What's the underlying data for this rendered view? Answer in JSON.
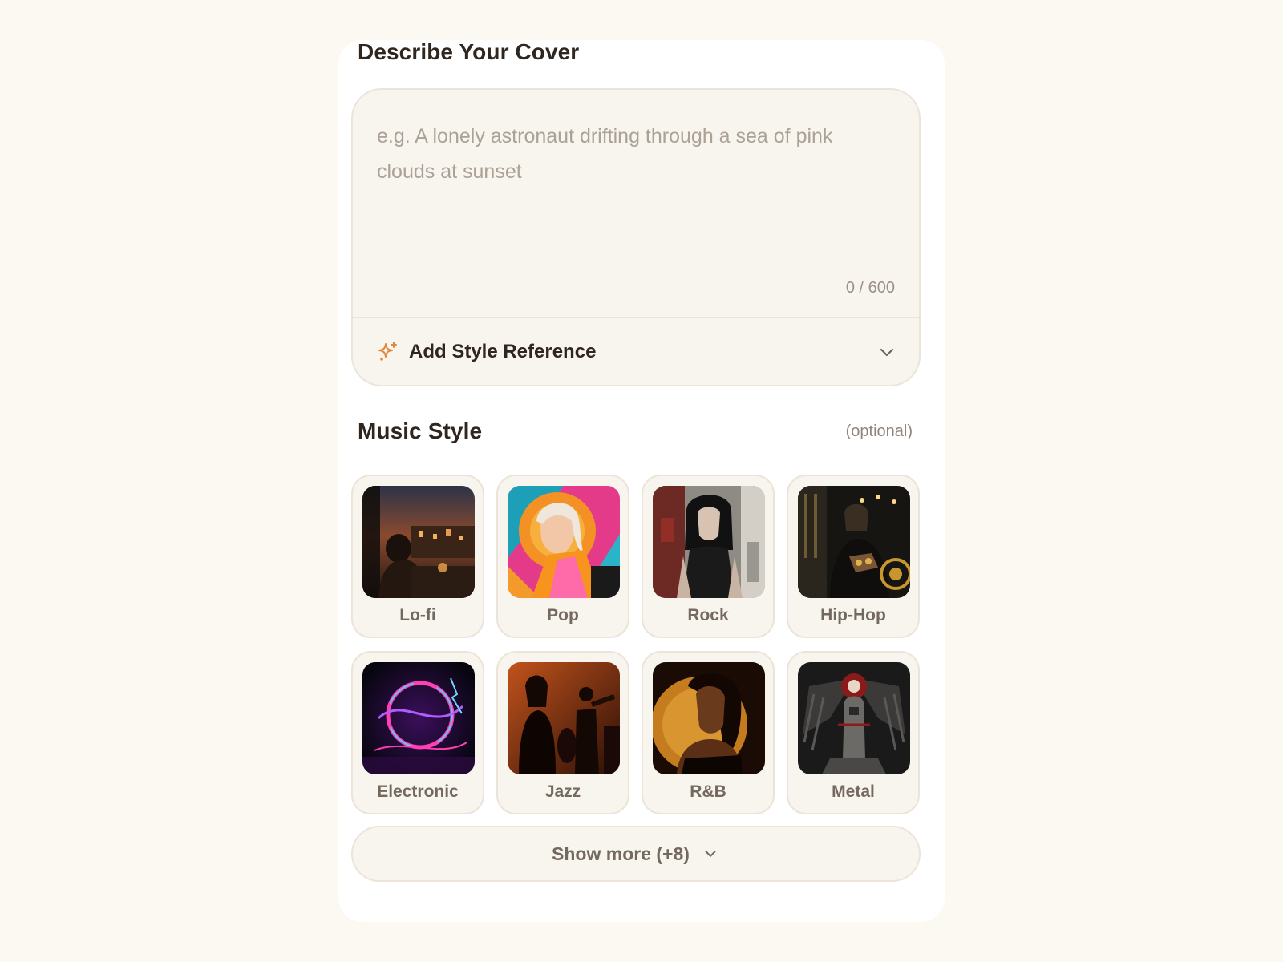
{
  "describe": {
    "title": "Describe Your Cover",
    "placeholder": "e.g. A lonely astronaut drifting through a sea of pink clouds at sunset",
    "value": "",
    "counter": "0 / 600"
  },
  "style_reference": {
    "label": "Add Style Reference",
    "icon": "sparkle-icon",
    "expand_icon": "chevron-down-icon"
  },
  "music_style": {
    "title": "Music Style",
    "optional": "(optional)",
    "items": [
      {
        "label": "Lo-fi",
        "image": "lofi-cover-thumbnail"
      },
      {
        "label": "Pop",
        "image": "pop-cover-thumbnail"
      },
      {
        "label": "Rock",
        "image": "rock-cover-thumbnail"
      },
      {
        "label": "Hip-Hop",
        "image": "hiphop-cover-thumbnail"
      },
      {
        "label": "Electronic",
        "image": "electronic-cover-thumbnail"
      },
      {
        "label": "Jazz",
        "image": "jazz-cover-thumbnail"
      },
      {
        "label": "R&B",
        "image": "rnb-cover-thumbnail"
      },
      {
        "label": "Metal",
        "image": "metal-cover-thumbnail"
      }
    ],
    "show_more": "Show more (+8)"
  },
  "colors": {
    "page_background": "#fcf9f3",
    "panel_background": "#ffffff",
    "field_background": "#f8f4ee",
    "border": "#ece4d9",
    "heading_text": "#2e261f",
    "muted_text": "#74695f",
    "placeholder_text": "#aca196",
    "accent": "#e0893c"
  }
}
